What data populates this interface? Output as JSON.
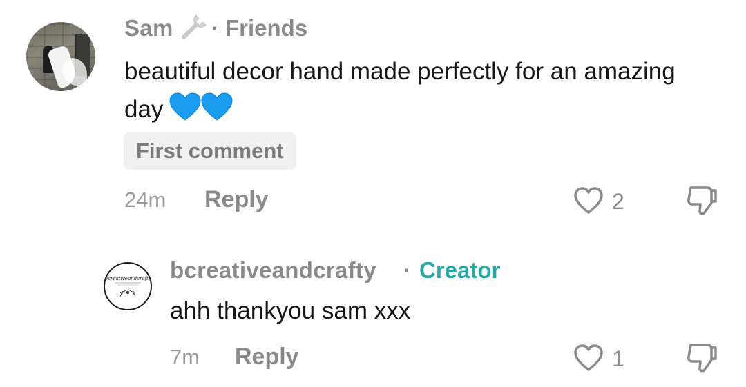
{
  "comments": [
    {
      "username": "Sam",
      "separator": "·",
      "tag": "Friends",
      "text": "beautiful decor hand made perfectly for an amazing day",
      "badge": "First comment",
      "time": "24m",
      "reply_label": "Reply",
      "likes": "2"
    },
    {
      "username": "bcreativeandcrafty",
      "separator": "·",
      "tag": "Creator",
      "text": "ahh thankyou sam xxx",
      "time": "7m",
      "reply_label": "Reply",
      "likes": "1"
    }
  ],
  "avatar2_logo": {
    "brand_text": "Bcreativeandcrafty"
  },
  "colors": {
    "username": "#8a8a8a",
    "creator_tag": "#2aa8a6",
    "body_text": "#161616",
    "heart_emoji": "#1a9cf0",
    "badge_bg": "#f1f1f1"
  },
  "icons": [
    "wrench-icon",
    "blue-heart-emoji",
    "heart-outline-icon",
    "dislike-icon"
  ]
}
